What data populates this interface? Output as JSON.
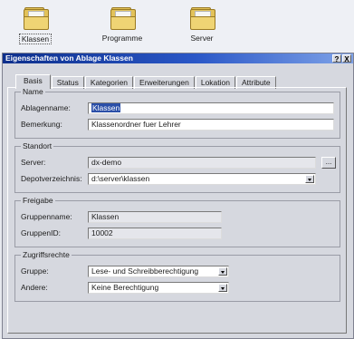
{
  "desktop": {
    "icons": [
      {
        "label": "Klassen",
        "icon": "folder-icon",
        "selected": true
      },
      {
        "label": "Programme",
        "icon": "folder-icon",
        "selected": false
      },
      {
        "label": "Server",
        "icon": "folder-icon",
        "selected": false
      }
    ]
  },
  "dialog": {
    "title": "Eigenschaften von Ablage Klassen",
    "help_label": "?",
    "close_label": "X",
    "tabs": [
      {
        "label": "Basis",
        "active": true
      },
      {
        "label": "Status",
        "active": false
      },
      {
        "label": "Kategorien",
        "active": false
      },
      {
        "label": "Erweiterungen",
        "active": false
      },
      {
        "label": "Lokation",
        "active": false
      },
      {
        "label": "Attribute",
        "active": false
      }
    ],
    "name_group": {
      "label": "Name",
      "ablagename_label": "Ablagenname:",
      "ablagename_value": "Klassen",
      "bemerkung_label": "Bemerkung:",
      "bemerkung_value": "Klassenordner fuer Lehrer"
    },
    "standort_group": {
      "label": "Standort",
      "server_label": "Server:",
      "server_value": "dx-demo",
      "browse_label": "...",
      "depot_label": "Depotverzeichnis:",
      "depot_value": "d:\\server\\klassen"
    },
    "freigabe_group": {
      "label": "Freigabe",
      "gruppenname_label": "Gruppenname:",
      "gruppenname_value": "Klassen",
      "gruppenid_label": "GruppenID:",
      "gruppenid_value": "10002"
    },
    "zugriff_group": {
      "label": "Zugriffsrechte",
      "gruppe_label": "Gruppe:",
      "gruppe_value": "Lese- und Schreibberechtigung",
      "andere_label": "Andere:",
      "andere_value": "Keine Berechtigung"
    }
  }
}
